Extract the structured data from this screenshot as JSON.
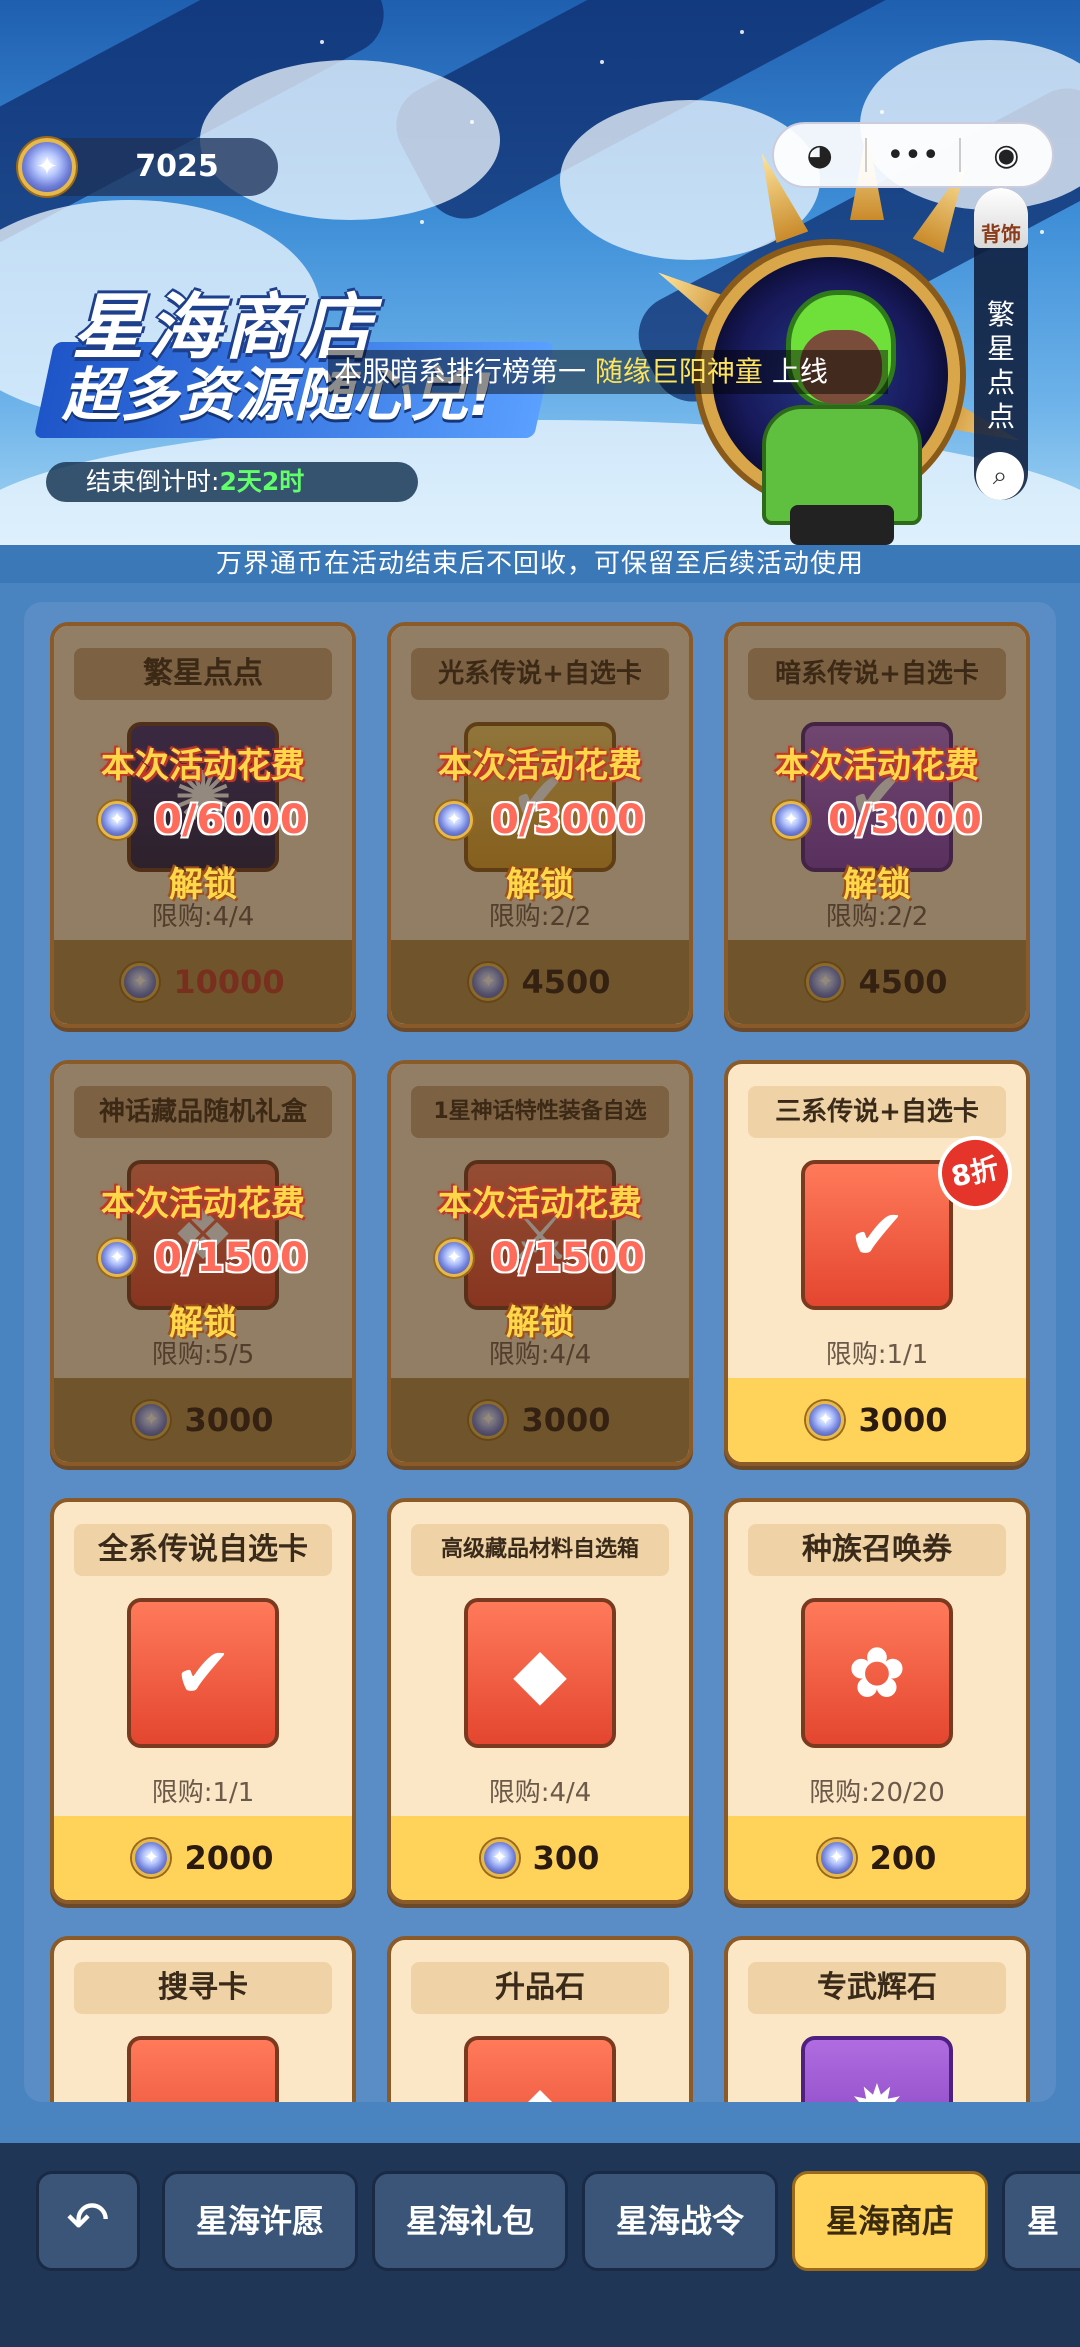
{
  "header": {
    "currency": {
      "icon": "star-coin-icon",
      "amount": "7025"
    },
    "title": "星海商店",
    "subtitle": "超多资源随心兑!",
    "countdown": {
      "label": "结束倒计时:",
      "value": "2天2时"
    },
    "ticker": {
      "prefix": "本服暗系排行榜第一 ",
      "highlight": "随缘巨阳神童",
      "suffix": " 上线"
    },
    "capsule": {
      "ghost_icon": "ghost-icon",
      "more_icon": "more-dots-icon",
      "record_icon": "target-icon"
    },
    "side_tab": {
      "badge": "背饰",
      "text": "繁星点点",
      "search_icon": "search-icon"
    }
  },
  "notice": "万界通币在活动结束后不回收，可保留至后续活动使用",
  "lock_text": {
    "spend": "本次活动花费",
    "unlock": "解锁"
  },
  "items": [
    {
      "name": "繁星点点",
      "limit": "限购:4/4",
      "price": "10000",
      "locked": true,
      "progress": "0/6000",
      "price_red": true,
      "icon": "stars-backpiece-icon"
    },
    {
      "name": "光系传说+自选卡",
      "limit": "限购:2/2",
      "price": "4500",
      "locked": true,
      "progress": "0/3000",
      "icon": "light-card-icon"
    },
    {
      "name": "暗系传说+自选卡",
      "limit": "限购:2/2",
      "price": "4500",
      "locked": true,
      "progress": "0/3000",
      "icon": "dark-card-icon"
    },
    {
      "name": "神话藏品随机礼盒",
      "limit": "限购:5/5",
      "price": "3000",
      "locked": true,
      "progress": "0/1500",
      "icon": "gift-box-icon"
    },
    {
      "name": "1星神话特性装备自选",
      "limit": "限购:4/4",
      "price": "3000",
      "locked": true,
      "progress": "0/1500",
      "icon": "equipment-chest-icon"
    },
    {
      "name": "三系传说+自选卡",
      "limit": "限购:1/1",
      "price": "3000",
      "locked": false,
      "discount": "8折",
      "icon": "check-card-icon"
    },
    {
      "name": "全系传说自选卡",
      "limit": "限购:1/1",
      "price": "2000",
      "locked": false,
      "icon": "rainbow-card-icon"
    },
    {
      "name": "高级藏品材料自选箱",
      "limit": "限购:4/4",
      "price": "300",
      "locked": false,
      "icon": "crystal-box-icon"
    },
    {
      "name": "种族召唤券",
      "limit": "限购:20/20",
      "price": "200",
      "locked": false,
      "icon": "summon-ticket-icon"
    },
    {
      "name": "搜寻卡",
      "locked": false,
      "icon": "search-card-icon"
    },
    {
      "name": "升品石",
      "locked": false,
      "icon": "upgrade-stone-icon"
    },
    {
      "name": "专武辉石",
      "locked": false,
      "icon": "weapon-gem-icon"
    }
  ],
  "nav": {
    "back_icon": "back-arrow-icon",
    "tabs": [
      "星海许愿",
      "星海礼包",
      "星海战令",
      "星海商店",
      "星"
    ],
    "active": "星海商店"
  }
}
